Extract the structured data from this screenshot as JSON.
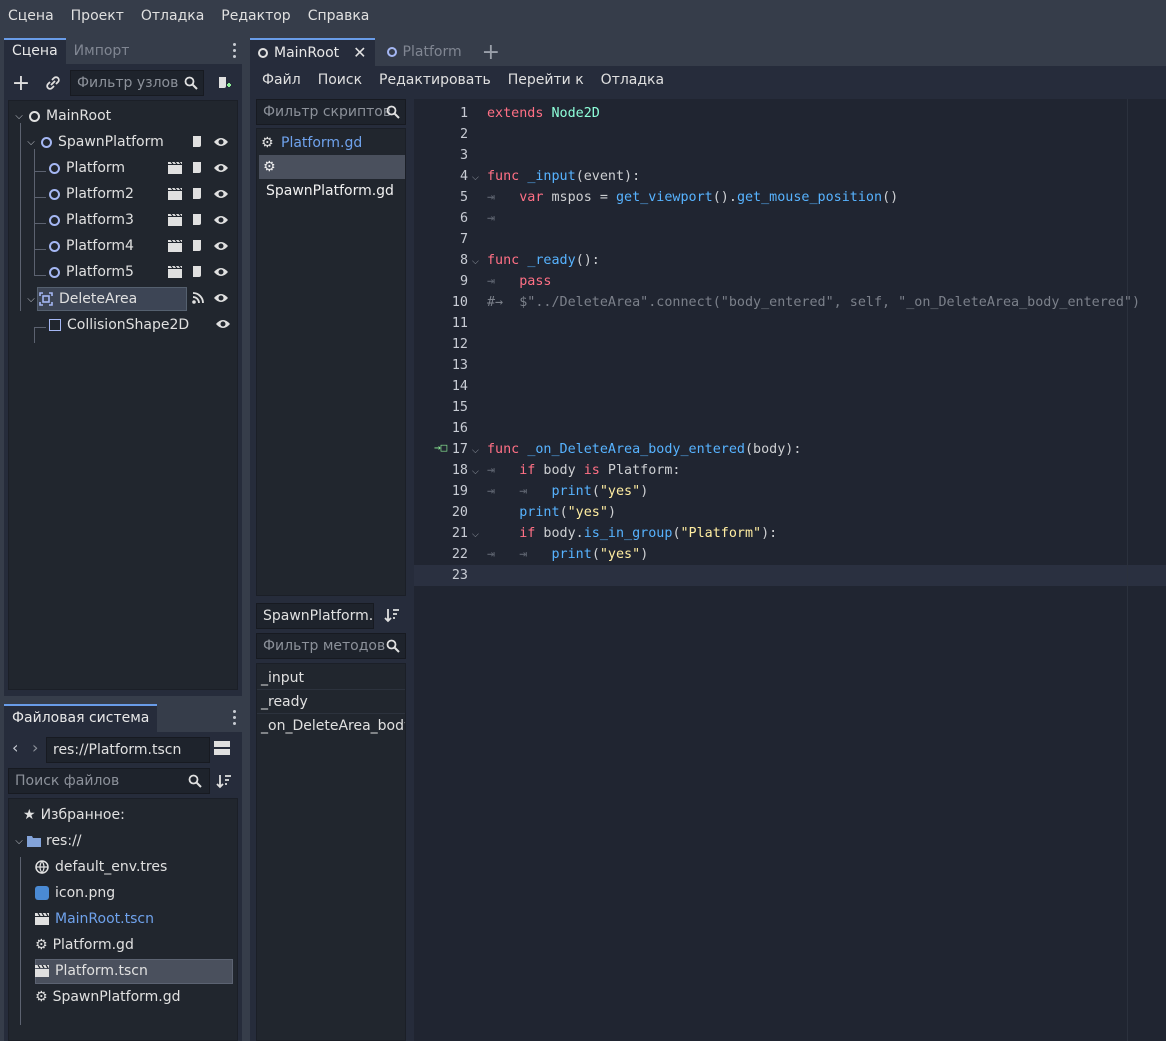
{
  "menu": [
    "Сцена",
    "Проект",
    "Отладка",
    "Редактор",
    "Справка"
  ],
  "scene_dock": {
    "tabs": [
      "Сцена",
      "Импорт"
    ],
    "filter_placeholder": "Фильтр узлов",
    "nodes": [
      {
        "label": "MainRoot"
      },
      {
        "label": "SpawnPlatform"
      },
      {
        "label": "Platform"
      },
      {
        "label": "Platform2"
      },
      {
        "label": "Platform3"
      },
      {
        "label": "Platform4"
      },
      {
        "label": "Platform5"
      },
      {
        "label": "DeleteArea"
      },
      {
        "label": "CollisionShape2D"
      }
    ]
  },
  "fs_dock": {
    "tab": "Файловая система",
    "path": "res://Platform.tscn",
    "search_placeholder": "Поиск файлов",
    "favorites": "Избранное:",
    "root": "res://",
    "files": [
      {
        "name": "default_env.tres"
      },
      {
        "name": "icon.png"
      },
      {
        "name": "MainRoot.tscn"
      },
      {
        "name": "Platform.gd"
      },
      {
        "name": "Platform.tscn"
      },
      {
        "name": "SpawnPlatform.gd"
      }
    ]
  },
  "editor_tabs": [
    "MainRoot",
    "Platform"
  ],
  "script_menu": [
    "Файл",
    "Поиск",
    "Редактировать",
    "Перейти к",
    "Отладка"
  ],
  "script_list": {
    "filter_placeholder": "Фильтр скриптов",
    "items": [
      "Platform.gd",
      "SpawnPlatform.gd"
    ]
  },
  "methods_panel": {
    "current_script": "SpawnPlatform.g",
    "filter_placeholder": "Фильтр методов",
    "items": [
      "_input",
      "_ready",
      "_on_DeleteArea_body_"
    ]
  },
  "code": {
    "line_numbers": [
      "1",
      "2",
      "3",
      "4",
      "5",
      "6",
      "7",
      "8",
      "9",
      "10",
      "11",
      "12",
      "13",
      "14",
      "15",
      "16",
      "17",
      "18",
      "19",
      "20",
      "21",
      "22",
      "23"
    ],
    "tokens": {
      "l1_kw": "extends",
      "l1_ty": "Node2D",
      "l4_kw": "func",
      "l4_fn": "_input",
      "l4_rest": "(event):",
      "l5_kw": "var",
      "l5_a": " mspos = ",
      "l5_fn1": "get_viewport",
      "l5_b": "().",
      "l5_fn2": "get_mouse_position",
      "l5_c": "()",
      "l8_kw": "func",
      "l8_fn": "_ready",
      "l8_rest": "():",
      "l9_kw": "pass",
      "l10_comment": "#→  $\"../DeleteArea\".connect(\"body_entered\", self, \"_on_DeleteArea_body_entered\")",
      "l17_kw": "func",
      "l17_fn": "_on_DeleteArea_body_entered",
      "l17_rest": "(body):",
      "l18_kw1": "if",
      "l18_a": " body ",
      "l18_kw2": "is",
      "l18_b": " Platform:",
      "l19_fn": "print",
      "l19_a": "(",
      "l19_st": "\"yes\"",
      "l19_b": ")",
      "l20_fn": "print",
      "l20_a": "(",
      "l20_st": "\"yes\"",
      "l20_b": ")",
      "l21_kw": "if",
      "l21_a": " body.",
      "l21_fn": "is_in_group",
      "l21_b": "(",
      "l21_st": "\"Platform\"",
      "l21_c": "):",
      "l22_fn": "print",
      "l22_a": "(",
      "l22_st": "\"yes\"",
      "l22_b": ")"
    }
  },
  "colors": {
    "accent": "#699ce8",
    "keyword": "#ff7085",
    "function": "#57b3ff",
    "type": "#8effda",
    "string": "#ffeda1"
  }
}
